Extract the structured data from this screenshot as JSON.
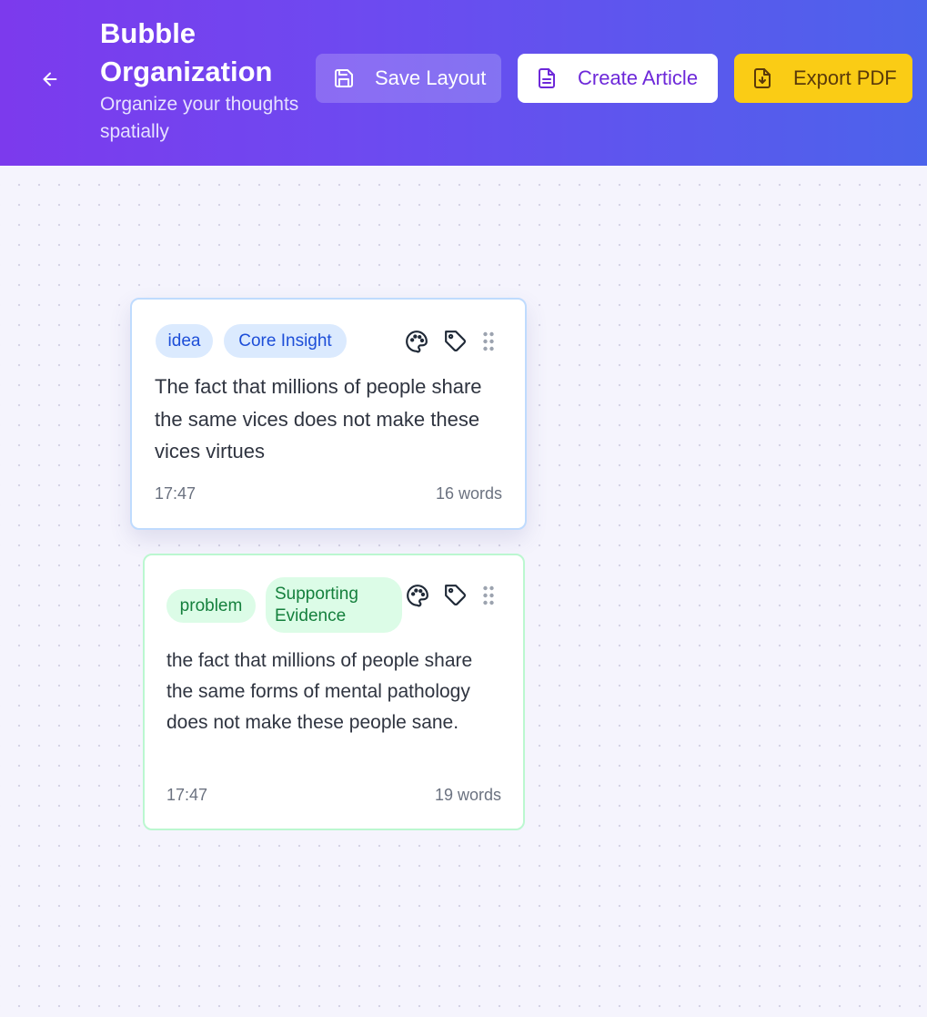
{
  "header": {
    "title": "Bubble Organization",
    "subtitle": "Organize your thoughts spatially",
    "back_icon": "arrow-left-icon",
    "buttons": {
      "save_layout": "Save Layout",
      "create_article": "Create Article",
      "export_pdf": "Export PDF"
    }
  },
  "bubbles": [
    {
      "tags": [
        "idea",
        "Core Insight"
      ],
      "text": "The fact that millions of people share the same vices does not make these vices virtues",
      "time": "17:47",
      "word_count": "16 words",
      "color": "#bfdbfe"
    },
    {
      "tags": [
        "problem",
        "Supporting Evidence"
      ],
      "text": "the fact that millions of people share the same forms of mental pathology does not make these people sane.",
      "time": "17:47",
      "word_count": "19 words",
      "color": "#bbf7d0"
    }
  ],
  "colors": {
    "header_start": "#7c3aed",
    "header_end": "#4c63eb",
    "accent_yellow": "#facc15"
  }
}
